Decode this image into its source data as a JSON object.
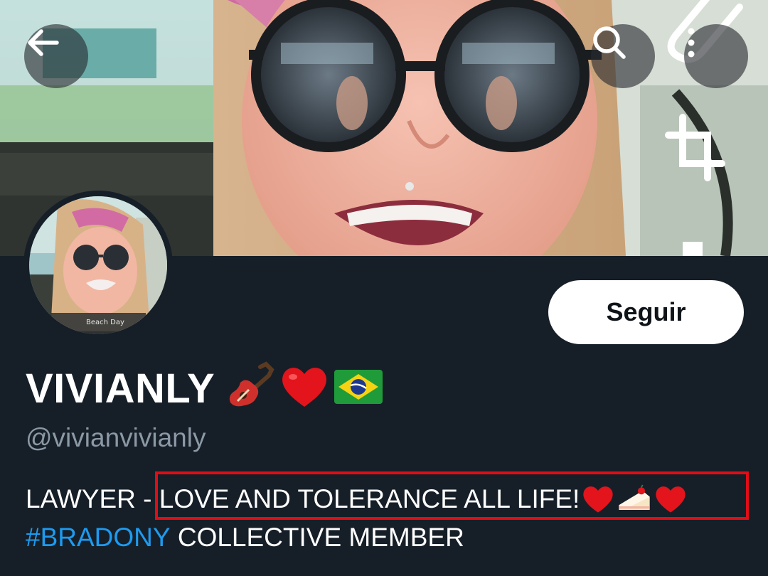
{
  "header": {
    "back_icon": "arrow-left-icon",
    "search_icon": "search-icon",
    "more_icon": "more-vertical-icon",
    "attachment_icon": "paperclip-icon",
    "crop_icon": "crop-icon"
  },
  "avatar": {
    "caption": "Beach Day"
  },
  "follow_button": {
    "label": "Seguir"
  },
  "profile": {
    "display_name": "VIVIANLY",
    "name_emojis": [
      "guitar-icon",
      "red-heart-icon",
      "brazil-flag-icon"
    ],
    "handle": "@vivianvivianly",
    "bio_line1_prefix": "LAWYER - ",
    "bio_line1_highlight": "LOVE AND TOLERANCE ALL LIFE!",
    "bio_line1_emojis": [
      "red-heart-icon",
      "cake-slice-icon",
      "red-heart-icon"
    ],
    "bio_line2_hashtag": "#BRADONY",
    "bio_line2_rest": " COLLECTIVE MEMBER"
  },
  "colors": {
    "background": "#161f28",
    "hashtag": "#1d9bf0",
    "handle": "#8b98a5",
    "highlight_border": "#e10d16",
    "follow_bg": "#ffffff"
  }
}
